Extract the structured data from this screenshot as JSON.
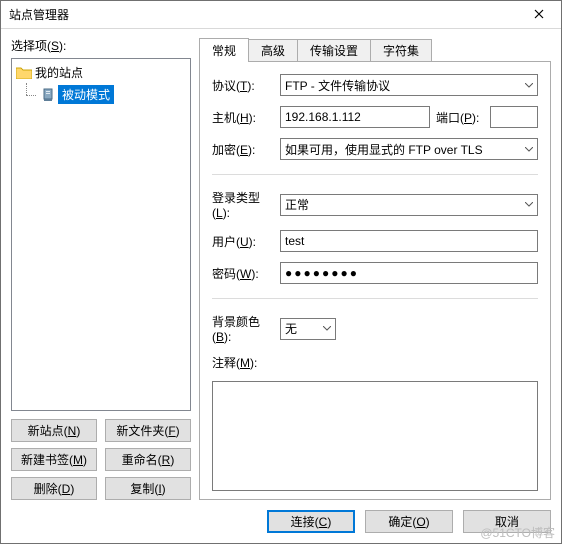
{
  "window": {
    "title": "站点管理器"
  },
  "left": {
    "select_label": "选择项(S):",
    "root_label": "我的站点",
    "site_label": "被动模式",
    "buttons": {
      "new_site": "新站点(N)",
      "new_folder": "新文件夹(F)",
      "new_bookmark": "新建书签(M)",
      "rename": "重命名(R)",
      "delete": "删除(D)",
      "copy": "复制(I)"
    }
  },
  "tabs": {
    "general": "常规",
    "advanced": "高级",
    "transfer": "传输设置",
    "charset": "字符集"
  },
  "form": {
    "protocol_label": "协议(T):",
    "protocol_value": "FTP - 文件传输协议",
    "host_label": "主机(H):",
    "host_value": "192.168.1.112",
    "port_label": "端口(P):",
    "port_value": "",
    "encryption_label": "加密(E):",
    "encryption_value": "如果可用，使用显式的 FTP over TLS",
    "logon_label": "登录类型(L):",
    "logon_value": "正常",
    "user_label": "用户(U):",
    "user_value": "test",
    "password_label": "密码(W):",
    "password_value": "●●●●●●●●",
    "bgcolor_label": "背景颜色(B):",
    "bgcolor_value": "无",
    "comments_label": "注释(M):",
    "comments_value": ""
  },
  "dialog": {
    "connect": "连接(C)",
    "ok": "确定(O)",
    "cancel": "取消"
  },
  "watermark": "@51CTO博客"
}
